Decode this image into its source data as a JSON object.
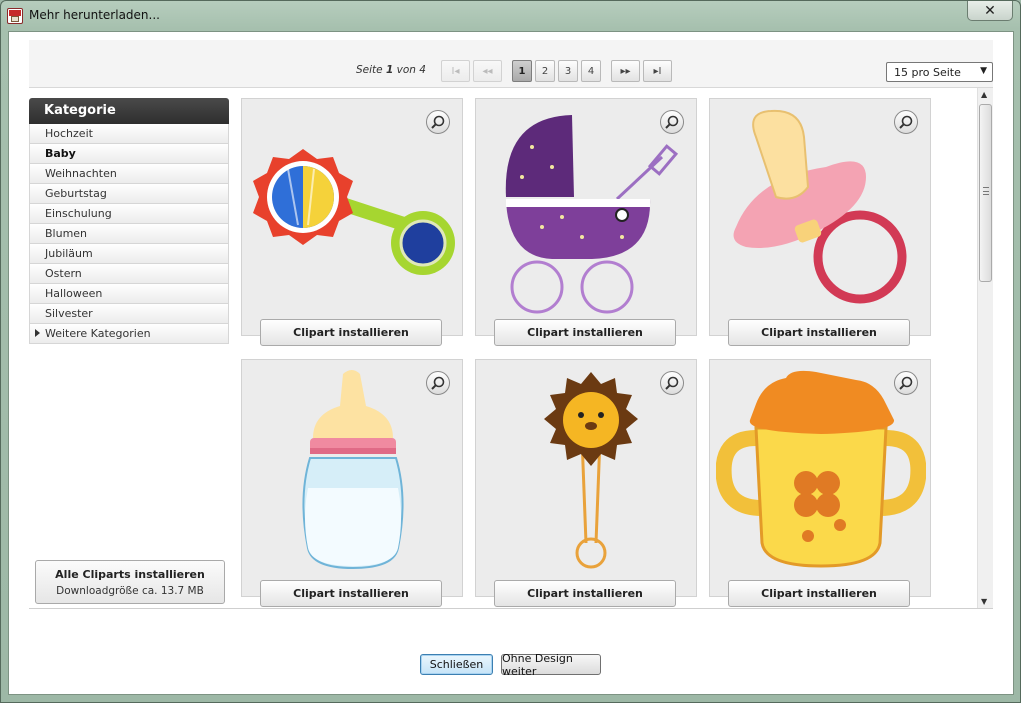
{
  "window": {
    "title": "Mehr herunterladen..."
  },
  "pager": {
    "prefix": "Seite",
    "current": "1",
    "of_label": "von",
    "total": "4",
    "first_label": "I◂",
    "prev_label": "◂◂",
    "next_label": "▸▸",
    "last_label": "▸I",
    "pages": [
      "1",
      "2",
      "3",
      "4"
    ]
  },
  "per_page": {
    "selected": "15 pro Seite"
  },
  "sidebar": {
    "header": "Kategorie",
    "items": [
      {
        "label": "Hochzeit"
      },
      {
        "label": "Baby"
      },
      {
        "label": "Weihnachten"
      },
      {
        "label": "Geburtstag"
      },
      {
        "label": "Einschulung"
      },
      {
        "label": "Blumen"
      },
      {
        "label": "Jubiläum"
      },
      {
        "label": "Ostern"
      },
      {
        "label": "Halloween"
      },
      {
        "label": "Silvester"
      },
      {
        "label": "Weitere Kategorien"
      }
    ]
  },
  "install_all": {
    "line1": "Alle Cliparts installieren",
    "line2": "Downloadgröße ca. 13.7 MB"
  },
  "cards": [
    {
      "icon": "baby-rattle",
      "button": "Clipart installieren"
    },
    {
      "icon": "baby-stroller",
      "button": "Clipart installieren"
    },
    {
      "icon": "pacifier",
      "button": "Clipart installieren"
    },
    {
      "icon": "baby-bottle",
      "button": "Clipart installieren"
    },
    {
      "icon": "lion-safety-pin",
      "button": "Clipart installieren"
    },
    {
      "icon": "sippy-cup",
      "button": "Clipart installieren"
    }
  ],
  "footer": {
    "close_label": "Schließen",
    "continue_label": "Ohne Design weiter"
  }
}
